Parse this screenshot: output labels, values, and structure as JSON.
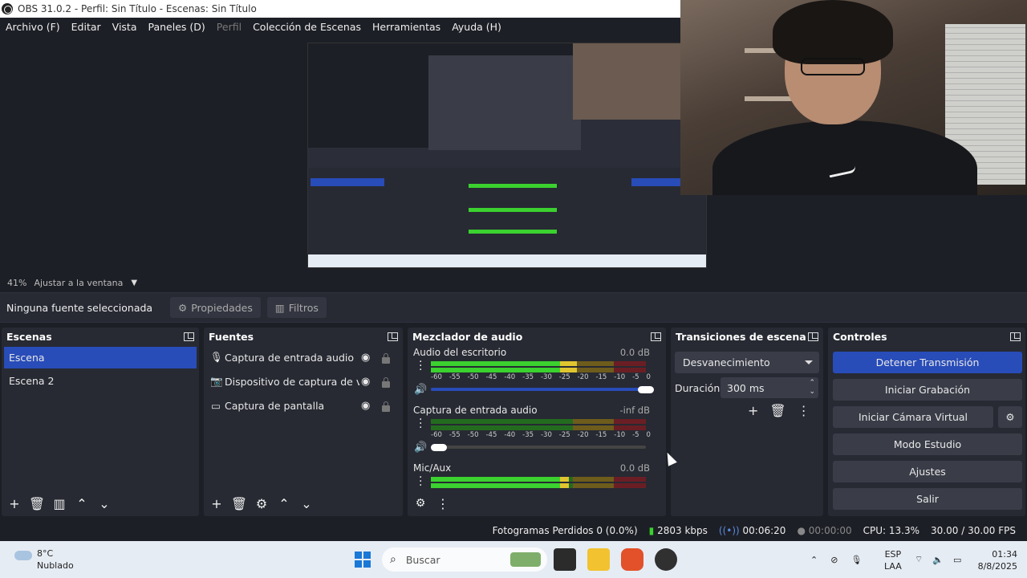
{
  "window": {
    "title": "OBS 31.0.2 - Perfil: Sin Título - Escenas: Sin Título"
  },
  "menu": {
    "items": [
      {
        "label": "Archivo (F)",
        "enabled": true
      },
      {
        "label": "Editar",
        "enabled": true
      },
      {
        "label": "Vista",
        "enabled": true
      },
      {
        "label": "Paneles (D)",
        "enabled": true
      },
      {
        "label": "Perfil",
        "enabled": false
      },
      {
        "label": "Colección de Escenas",
        "enabled": true
      },
      {
        "label": "Herramientas",
        "enabled": true
      },
      {
        "label": "Ayuda (H)",
        "enabled": true
      }
    ]
  },
  "preview": {
    "zoom": "41%",
    "fit_label": "Ajustar a la ventana"
  },
  "source_toolbar": {
    "no_source": "Ninguna fuente seleccionada",
    "properties_label": "Propiedades",
    "filters_label": "Filtros"
  },
  "scenes": {
    "title": "Escenas",
    "items": [
      {
        "label": "Escena",
        "active": true
      },
      {
        "label": "Escena 2",
        "active": false
      }
    ]
  },
  "sources": {
    "title": "Fuentes",
    "items": [
      {
        "label": "Captura de entrada audio",
        "icon": "microphone-icon"
      },
      {
        "label": "Dispositivo de captura de video",
        "icon": "camera-icon"
      },
      {
        "label": "Captura de pantalla",
        "icon": "monitor-icon"
      }
    ]
  },
  "mixer": {
    "title": "Mezclador de audio",
    "ticks": [
      "-60",
      "-55",
      "-50",
      "-45",
      "-40",
      "-35",
      "-30",
      "-25",
      "-20",
      "-15",
      "-10",
      "-5",
      "0"
    ],
    "channels": [
      {
        "name": "Audio del escritorio",
        "db": "0.0 dB",
        "level": 0.68,
        "volume": 1.0
      },
      {
        "name": "Captura de entrada audio",
        "db": "-inf dB",
        "level": 0.0,
        "volume": 0.0
      },
      {
        "name": "Mic/Aux",
        "db": "0.0 dB",
        "level": 0.64,
        "volume": 1.0
      }
    ]
  },
  "transitions": {
    "title": "Transiciones de escena",
    "selected": "Desvanecimiento",
    "duration_label": "Duración",
    "duration_value": "300 ms"
  },
  "controls": {
    "title": "Controles",
    "buttons": {
      "stop_stream": "Detener Transmisión",
      "start_recording": "Iniciar Grabación",
      "virtual_cam": "Iniciar Cámara Virtual",
      "studio_mode": "Modo Estudio",
      "settings": "Ajustes",
      "exit": "Salir"
    }
  },
  "status": {
    "dropped_frames": "Fotogramas Perdidos 0 (0.0%)",
    "bitrate": "2803 kbps",
    "stream_time": "00:06:20",
    "record_time": "00:00:00",
    "cpu": "CPU: 13.3%",
    "fps": "30.00 / 30.00 FPS"
  },
  "taskbar": {
    "weather_temp": "8°C",
    "weather_desc": "Nublado",
    "search_placeholder": "Buscar",
    "lang_top": "ESP",
    "lang_bottom": "LAA",
    "time": "01:34",
    "date": "8/8/2025"
  },
  "colors": {
    "accent": "#284cb8",
    "panel": "#272a33",
    "background": "#1d1f26"
  }
}
